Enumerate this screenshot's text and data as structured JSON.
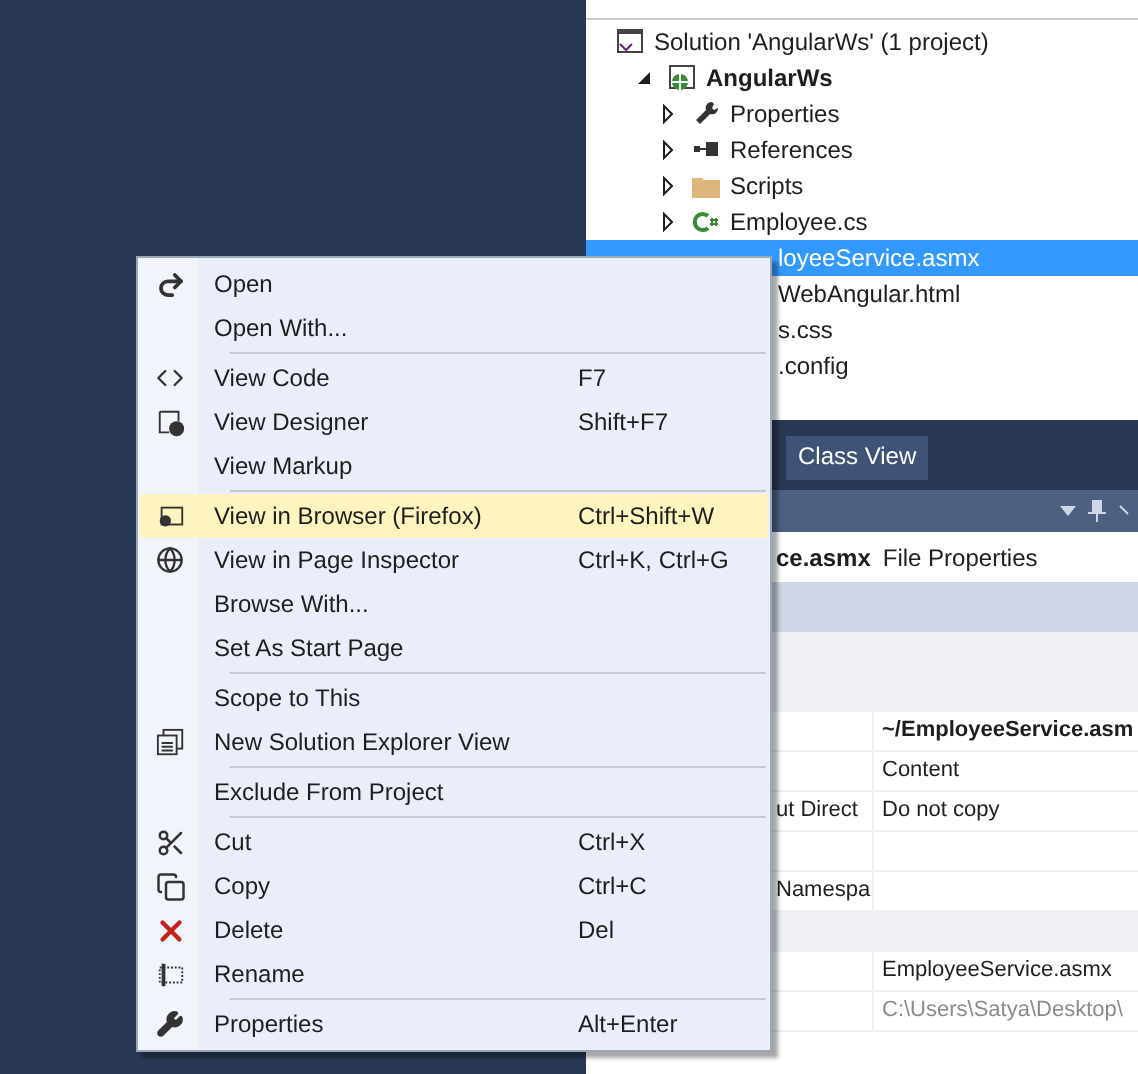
{
  "solution_explorer": {
    "tree": [
      {
        "label": "Solution 'AngularWs' (1 project)",
        "bold": false,
        "selected": false,
        "clipped": false,
        "children": [
          {
            "label": "AngularWs",
            "bold": true,
            "selected": false,
            "clipped": false,
            "expanded": true,
            "children": [
              {
                "label": "Properties",
                "bold": false,
                "selected": false,
                "clipped": false,
                "expanded": false
              },
              {
                "label": "References",
                "bold": false,
                "selected": false,
                "clipped": false,
                "expanded": false
              },
              {
                "label": "Scripts",
                "bold": false,
                "selected": false,
                "clipped": false,
                "expanded": false
              },
              {
                "label": "Employee.cs",
                "bold": false,
                "selected": false,
                "clipped": false,
                "expanded": false
              },
              {
                "label": "loyeeService.asmx",
                "bold": false,
                "selected": true,
                "clipped": true
              },
              {
                "label": "WebAngular.html",
                "bold": false,
                "selected": false,
                "clipped": true
              },
              {
                "label": "s.css",
                "bold": false,
                "selected": false,
                "clipped": true
              },
              {
                "label": ".config",
                "bold": false,
                "selected": false,
                "clipped": true
              }
            ]
          }
        ]
      }
    ]
  },
  "tabs": [
    {
      "label": "Class View",
      "selected": true
    }
  ],
  "properties": {
    "object_name": "ce.asmx",
    "object_type": "File Properties",
    "rows": [
      {
        "kind": "category"
      },
      {
        "kind": "category"
      },
      {
        "kind": "property",
        "value": "~/EmployeeService.asm",
        "bold": true,
        "disabled": false
      },
      {
        "kind": "property",
        "value": "Content",
        "bold": false,
        "disabled": false
      },
      {
        "kind": "property",
        "name": "ut Direct",
        "value": "Do not copy",
        "bold": false,
        "disabled": false
      },
      {
        "kind": "property"
      },
      {
        "kind": "property",
        "name": "Namespa"
      },
      {
        "kind": "category"
      },
      {
        "kind": "property",
        "value": "EmployeeService.asmx",
        "bold": false,
        "disabled": false
      },
      {
        "kind": "property",
        "value": "C:\\Users\\Satya\\Desktop\\",
        "bold": false,
        "disabled": true
      }
    ]
  },
  "context_menu": [
    {
      "kind": "item",
      "label": "Open",
      "selected": false
    },
    {
      "kind": "item",
      "label": "Open With...",
      "selected": false
    },
    {
      "kind": "separator"
    },
    {
      "kind": "item",
      "label": "View Code",
      "shortcut": "F7",
      "selected": false
    },
    {
      "kind": "item",
      "label": "View Designer",
      "shortcut": "Shift+F7",
      "selected": false
    },
    {
      "kind": "item",
      "label": "View Markup",
      "selected": false
    },
    {
      "kind": "separator"
    },
    {
      "kind": "item",
      "label": "View in Browser (Firefox)",
      "shortcut": "Ctrl+Shift+W",
      "selected": true
    },
    {
      "kind": "item",
      "label": "View in Page Inspector",
      "shortcut": "Ctrl+K, Ctrl+G",
      "selected": false
    },
    {
      "kind": "item",
      "label": "Browse With...",
      "selected": false
    },
    {
      "kind": "item",
      "label": "Set As Start Page",
      "selected": false
    },
    {
      "kind": "separator"
    },
    {
      "kind": "item",
      "label": "Scope to This",
      "selected": false
    },
    {
      "kind": "item",
      "label": "New Solution Explorer View",
      "selected": false
    },
    {
      "kind": "separator"
    },
    {
      "kind": "item",
      "label": "Exclude From Project",
      "selected": false
    },
    {
      "kind": "separator"
    },
    {
      "kind": "item",
      "label": "Cut",
      "shortcut": "Ctrl+X",
      "selected": false
    },
    {
      "kind": "item",
      "label": "Copy",
      "shortcut": "Ctrl+C",
      "selected": false
    },
    {
      "kind": "item",
      "label": "Delete",
      "shortcut": "Del",
      "selected": false
    },
    {
      "kind": "item",
      "label": "Rename",
      "selected": false
    },
    {
      "kind": "separator"
    },
    {
      "kind": "item",
      "label": "Properties",
      "shortcut": "Alt+Enter",
      "selected": false
    }
  ]
}
